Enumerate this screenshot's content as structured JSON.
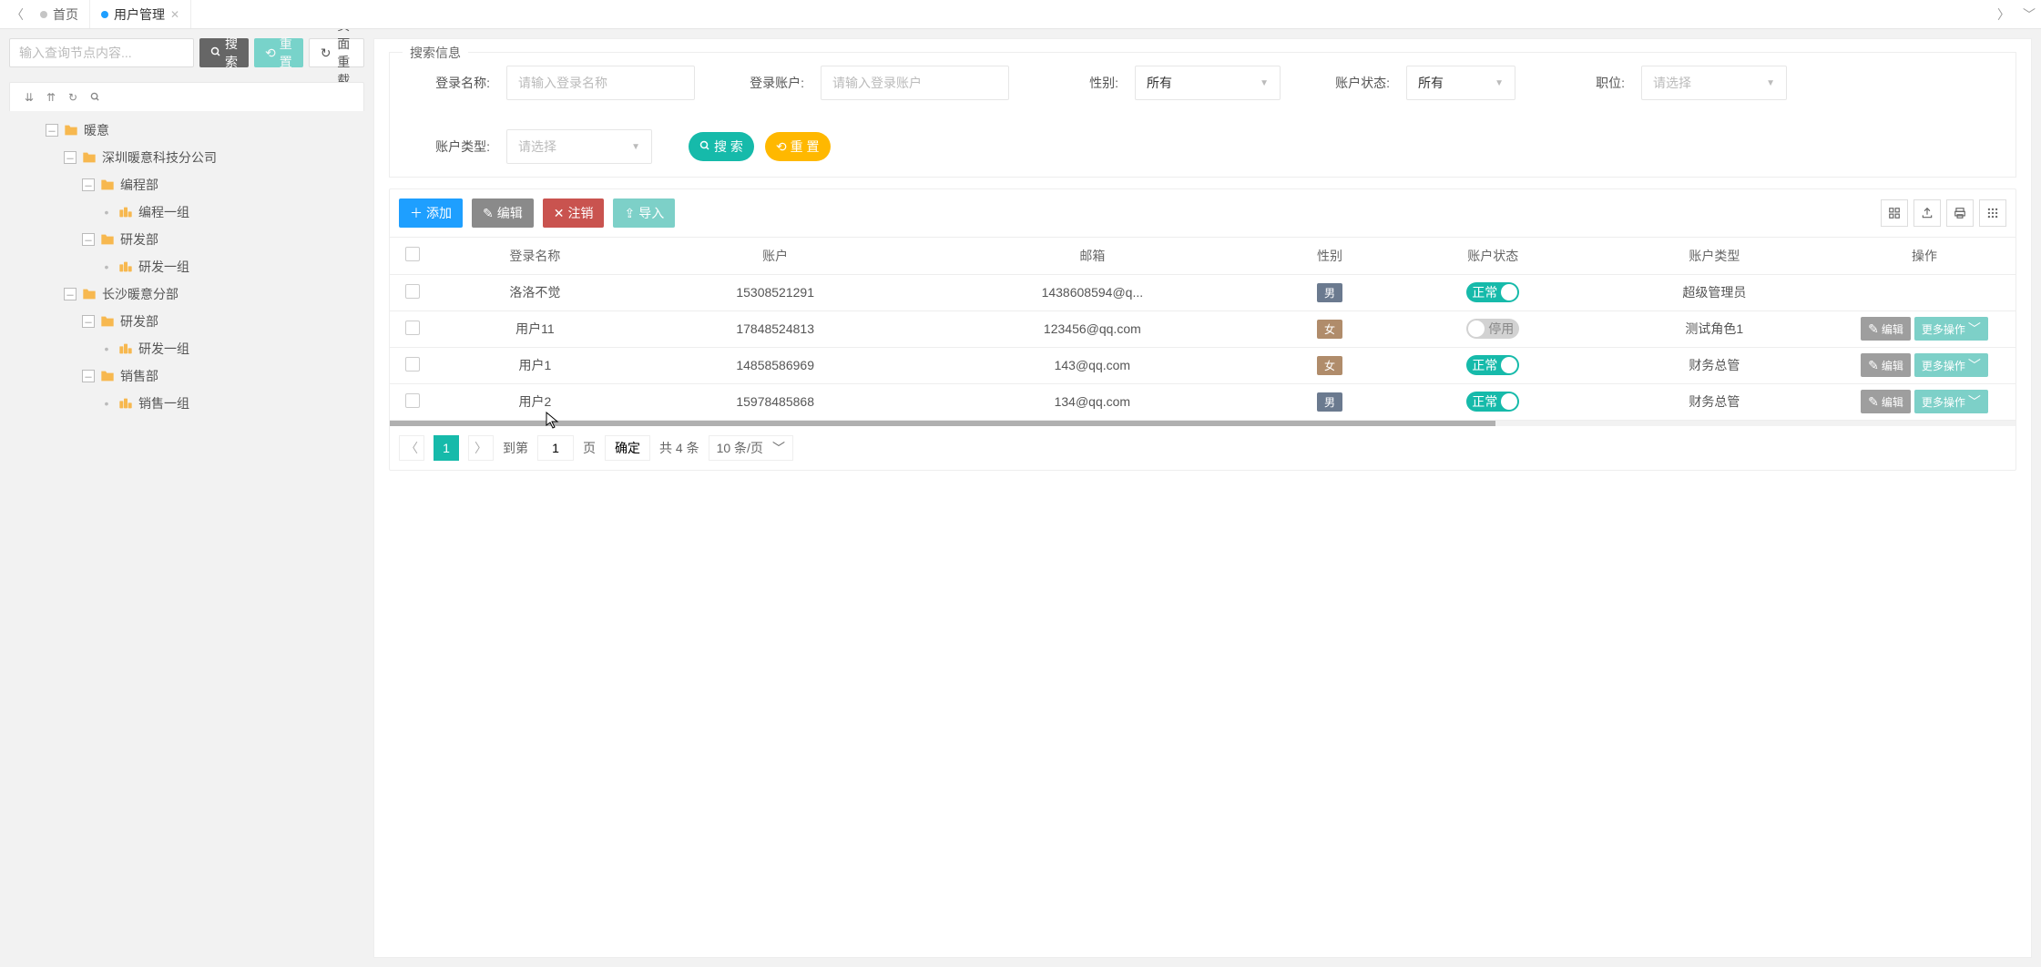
{
  "tabs": {
    "home": "首页",
    "active": "用户管理"
  },
  "sidebar": {
    "search_placeholder": "输入查询节点内容...",
    "search_btn": "搜索",
    "reset_btn": "重置",
    "reload_btn": "页面重载",
    "tree": [
      {
        "label": "暖意",
        "depth": 0,
        "folder": true,
        "open": true
      },
      {
        "label": "深圳暖意科技分公司",
        "depth": 1,
        "folder": true,
        "open": true
      },
      {
        "label": "编程部",
        "depth": 2,
        "folder": true,
        "open": true
      },
      {
        "label": "编程一组",
        "depth": 3,
        "folder": false,
        "open": false
      },
      {
        "label": "研发部",
        "depth": 2,
        "folder": true,
        "open": true
      },
      {
        "label": "研发一组",
        "depth": 3,
        "folder": false,
        "open": false
      },
      {
        "label": "长沙暖意分部",
        "depth": 1,
        "folder": true,
        "open": true
      },
      {
        "label": "研发部",
        "depth": 2,
        "folder": true,
        "open": true
      },
      {
        "label": "研发一组",
        "depth": 3,
        "folder": false,
        "open": false
      },
      {
        "label": "销售部",
        "depth": 2,
        "folder": true,
        "open": true
      },
      {
        "label": "销售一组",
        "depth": 3,
        "folder": false,
        "open": false
      }
    ]
  },
  "search": {
    "legend": "搜索信息",
    "login_name_label": "登录名称:",
    "login_name_ph": "请输入登录名称",
    "login_acct_label": "登录账户:",
    "login_acct_ph": "请输入登录账户",
    "gender_label": "性别:",
    "gender_value": "所有",
    "status_label": "账户状态:",
    "status_value": "所有",
    "position_label": "职位:",
    "position_ph": "请选择",
    "type_label": "账户类型:",
    "type_ph": "请选择",
    "search_btn": "搜 索",
    "reset_btn": "重 置"
  },
  "toolbar": {
    "add": "添加",
    "edit": "编辑",
    "logout": "注销",
    "import": "导入"
  },
  "table": {
    "headers": [
      "登录名称",
      "账户",
      "邮箱",
      "性别",
      "账户状态",
      "账户类型",
      "操作"
    ],
    "rows": [
      {
        "name": "洛洛不觉",
        "acct": "15308521291",
        "email": "1438608594@q...",
        "gender": "男",
        "status_on": true,
        "status_text": "正常",
        "type": "超级管理员",
        "ops": false
      },
      {
        "name": "用户11",
        "acct": "17848524813",
        "email": "123456@qq.com",
        "gender": "女",
        "status_on": false,
        "status_text": "停用",
        "type": "测试角色1",
        "ops": true
      },
      {
        "name": "用户1",
        "acct": "14858586969",
        "email": "143@qq.com",
        "gender": "女",
        "status_on": true,
        "status_text": "正常",
        "type": "财务总管",
        "ops": true
      },
      {
        "name": "用户2",
        "acct": "15978485868",
        "email": "134@qq.com",
        "gender": "男",
        "status_on": true,
        "status_text": "正常",
        "type": "财务总管",
        "ops": true
      }
    ],
    "op_edit": "编辑",
    "op_more": "更多操作"
  },
  "pager": {
    "page": "1",
    "goto_label": "到第",
    "goto_value": "1",
    "page_unit": "页",
    "ok": "确定",
    "total": "共 4 条",
    "size": "10 条/页"
  }
}
